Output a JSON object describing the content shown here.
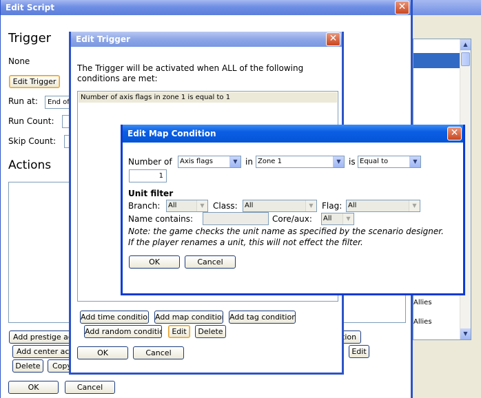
{
  "edit_script": {
    "title": "Edit Script",
    "trigger_heading": "Trigger",
    "trigger_value": "None",
    "edit_trigger_label": "Edit Trigger",
    "run_at_label": "Run at:",
    "run_at_value": "End of",
    "run_count_label": "Run Count:",
    "skip_count_label": "Skip Count:",
    "actions_heading": "Actions",
    "buttons": {
      "add_prestige": "Add prestige acti",
      "add_center": "Add center actio",
      "delete": "Delete",
      "copy": "Copy",
      "ok": "OK",
      "cancel": "Cancel"
    }
  },
  "background_panel": {
    "list_items": [
      "Allies",
      "Allies"
    ],
    "partial_button": "tion",
    "edit_button": "Edit"
  },
  "edit_trigger": {
    "title": "Edit Trigger",
    "description": "The Trigger will be activated when ALL of the following conditions are met:",
    "conditions": [
      "Number of axis flags in zone 1 is equal to 1"
    ],
    "buttons": {
      "add_time": "Add time condition",
      "add_map": "Add map condition",
      "add_tag": "Add tag condition",
      "add_random": "Add random condition",
      "edit": "Edit",
      "delete": "Delete",
      "ok": "OK",
      "cancel": "Cancel"
    }
  },
  "edit_map_condition": {
    "title": "Edit Map Condition",
    "number_of_label": "Number of",
    "number_of_value": "Axis flags",
    "in_label": "in",
    "zone_value": "Zone 1",
    "is_label": "is",
    "comparison_value": "Equal to",
    "count_value": "1",
    "unit_filter_heading": "Unit filter",
    "branch_label": "Branch:",
    "branch_value": "All",
    "class_label": "Class:",
    "class_value": "All",
    "flag_label": "Flag:",
    "flag_value": "All",
    "name_contains_label": "Name contains:",
    "name_contains_value": "",
    "core_aux_label": "Core/aux:",
    "core_aux_value": "All",
    "note": "Note: the game checks the unit name as specified by the scenario designer. If the player renames a unit, this will not effect the filter.",
    "ok": "OK",
    "cancel": "Cancel"
  }
}
